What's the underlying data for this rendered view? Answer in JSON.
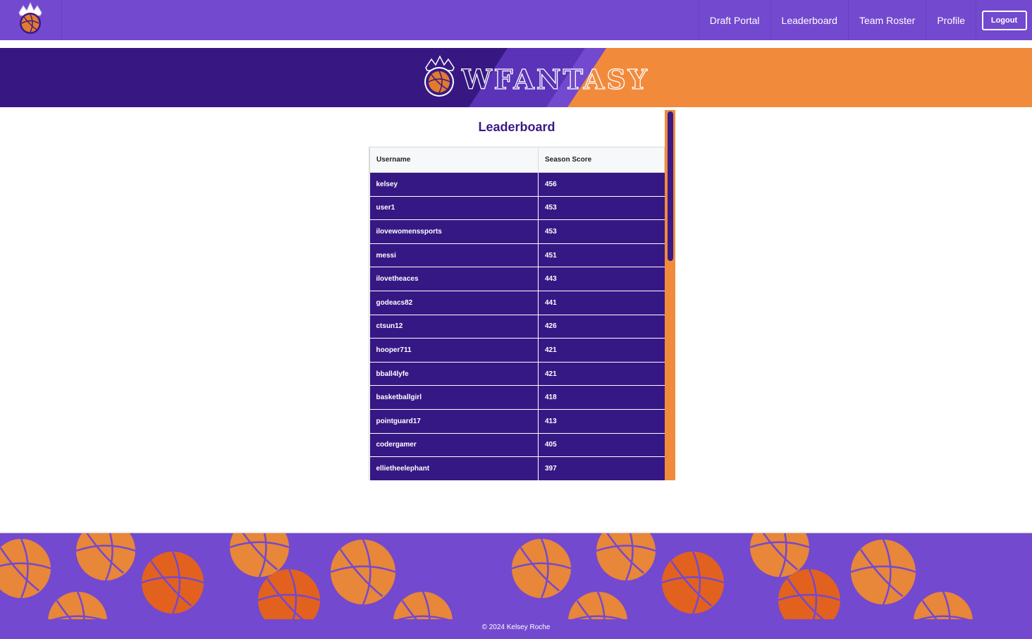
{
  "nav": {
    "links": [
      "Draft Portal",
      "Leaderboard",
      "Team Roster",
      "Profile"
    ],
    "logout_label": "Logout"
  },
  "banner": {
    "brand_text": "WFANTASY"
  },
  "leaderboard": {
    "title": "Leaderboard",
    "columns": [
      "Username",
      "Season Score"
    ],
    "rows": [
      {
        "username": "kelsey",
        "score": "456"
      },
      {
        "username": "user1",
        "score": "453"
      },
      {
        "username": "ilovewomenssports",
        "score": "453"
      },
      {
        "username": "messi",
        "score": "451"
      },
      {
        "username": "ilovetheaces",
        "score": "443"
      },
      {
        "username": "godeacs82",
        "score": "441"
      },
      {
        "username": "ctsun12",
        "score": "426"
      },
      {
        "username": "hooper711",
        "score": "421"
      },
      {
        "username": "bball4lyfe",
        "score": "421"
      },
      {
        "username": "basketballgirl",
        "score": "418"
      },
      {
        "username": "pointguard17",
        "score": "413"
      },
      {
        "username": "codergamer",
        "score": "405"
      },
      {
        "username": "ellietheelephant",
        "score": "397"
      }
    ]
  },
  "footer": {
    "copyright": "© 2024 Kelsey Roche"
  },
  "colors": {
    "nav_purple": "#7349cf",
    "dark_purple": "#361884",
    "orange": "#f28a3c"
  }
}
